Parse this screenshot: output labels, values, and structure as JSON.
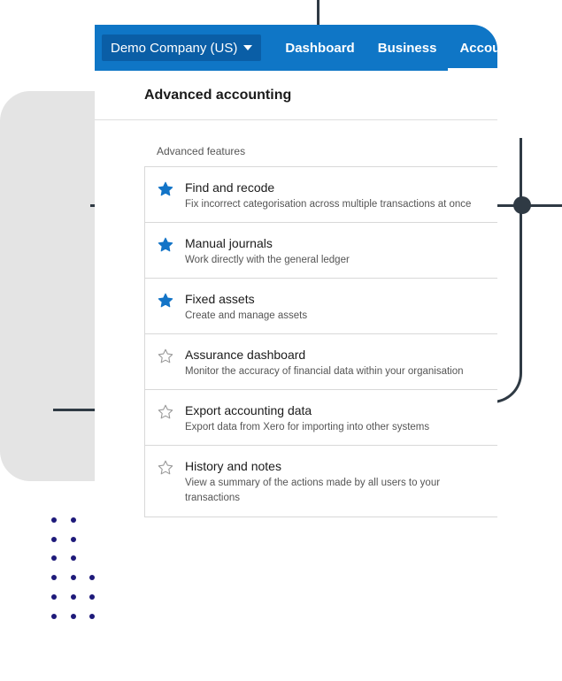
{
  "topbar": {
    "org_name": "Demo Company (US)",
    "tabs": [
      "Dashboard",
      "Business",
      "Accounting"
    ],
    "active_tab": "Accounting"
  },
  "page": {
    "title": "Advanced accounting"
  },
  "section": {
    "label": "Advanced features"
  },
  "features": [
    {
      "title": "Find and recode",
      "description": "Fix incorrect categorisation across multiple transactions at once",
      "starred": true
    },
    {
      "title": "Manual journals",
      "description": "Work directly with the general ledger",
      "starred": true
    },
    {
      "title": "Fixed assets",
      "description": "Create and manage assets",
      "starred": true
    },
    {
      "title": "Assurance dashboard",
      "description": "Monitor the accuracy of financial data within your organisation",
      "starred": false
    },
    {
      "title": "Export accounting data",
      "description": "Export data from Xero for importing into other systems",
      "starred": false
    },
    {
      "title": "History and notes",
      "description": "View a summary of the actions made by all users to your transactions",
      "starred": false
    }
  ],
  "colors": {
    "brand_blue": "#0f76c6",
    "star_filled": "#1374c7",
    "star_empty": "#9a9a9a",
    "decor_dots": "#1e1a7a"
  },
  "icons": {
    "starred": "star-filled-icon",
    "unstarred": "star-outline-icon",
    "org_menu": "caret-down-icon"
  }
}
